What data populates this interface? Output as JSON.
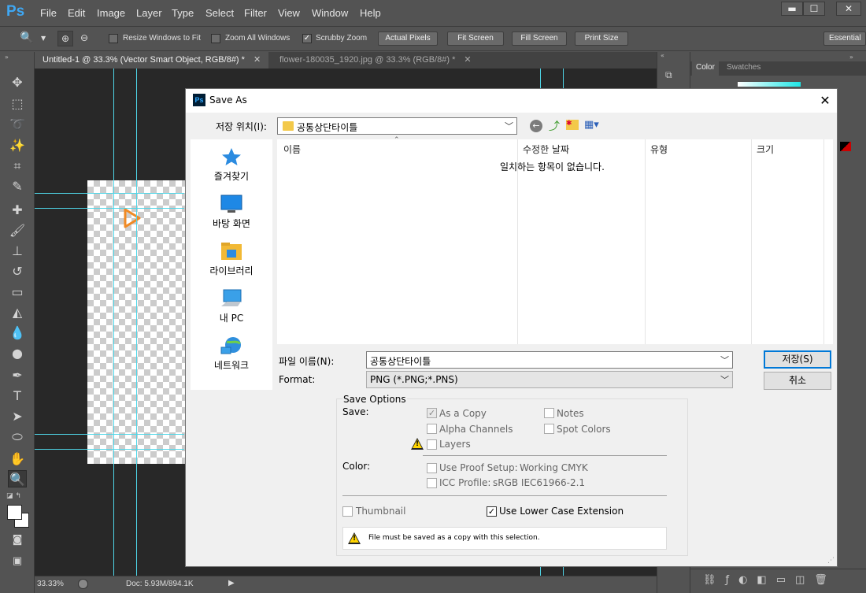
{
  "app": {
    "logo": "Ps"
  },
  "menu": [
    "File",
    "Edit",
    "Image",
    "Layer",
    "Type",
    "Select",
    "Filter",
    "View",
    "Window",
    "Help"
  ],
  "window_controls": {
    "minimize": "▬",
    "maximize": "☐",
    "close": "✕"
  },
  "options_bar": {
    "resize_windows": "Resize Windows to Fit",
    "zoom_all": "Zoom All Windows",
    "scrubby_zoom": "Scrubby Zoom",
    "actual_pixels": "Actual Pixels",
    "fit_screen": "Fit Screen",
    "fill_screen": "Fill Screen",
    "print_size": "Print Size",
    "workspace": "Essential"
  },
  "doc_tabs": [
    {
      "label": "Untitled-1 @ 33.3% (Vector Smart Object, RGB/8#) *",
      "active": true
    },
    {
      "label": "flower-180035_1920.jpg @ 33.3% (RGB/8#) *",
      "active": false
    }
  ],
  "statusbar": {
    "zoom": "33.33%",
    "doc": "Doc: 5.93M/894.1K"
  },
  "panels": {
    "color_tab": "Color",
    "swatches_tab": "Swatches"
  },
  "dialog": {
    "title": "Save As",
    "save_in_label": "저장 위치(I):",
    "save_in_value": "공통상단타이틀",
    "places": [
      "즐겨찾기",
      "바탕 화면",
      "라이브러리",
      "내 PC",
      "네트워크"
    ],
    "columns": [
      "이름",
      "수정한 날짜",
      "유형",
      "크기"
    ],
    "empty_message": "일치하는 항목이 없습니다.",
    "filename_label": "파일 이름(N):",
    "filename_value": "공통상단타이틀",
    "format_label": "Format:",
    "format_value": "PNG (*.PNG;*.PNS)",
    "save_button": "저장(S)",
    "cancel_button": "취소",
    "save_options_title": "Save Options",
    "save_label": "Save:",
    "as_copy": "As a Copy",
    "notes": "Notes",
    "alpha_channels": "Alpha Channels",
    "spot_colors": "Spot Colors",
    "layers": "Layers",
    "color_label": "Color:",
    "use_proof_setup": "Use Proof Setup:",
    "proof_profile": "Working CMYK",
    "icc_profile": "ICC Profile:",
    "icc_value": "sRGB IEC61966-2.1",
    "thumbnail": "Thumbnail",
    "lower_case": "Use Lower Case Extension",
    "warning_message": "File must be saved as a copy with this selection."
  }
}
